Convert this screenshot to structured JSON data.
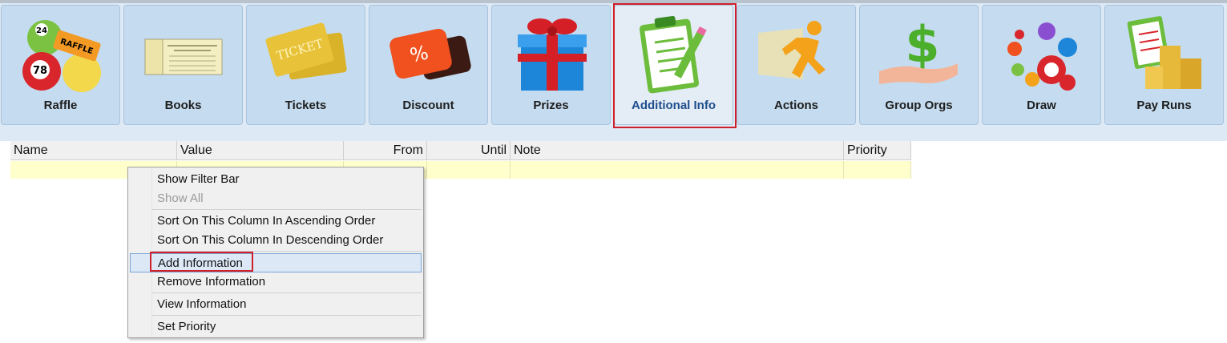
{
  "toolbar": {
    "buttons": [
      {
        "label": "Raffle",
        "icon": "raffle-balls-icon"
      },
      {
        "label": "Books",
        "icon": "books-icon"
      },
      {
        "label": "Tickets",
        "icon": "tickets-icon"
      },
      {
        "label": "Discount",
        "icon": "discount-icon"
      },
      {
        "label": "Prizes",
        "icon": "gift-icon"
      },
      {
        "label": "Additional Info",
        "icon": "clipboard-icon"
      },
      {
        "label": "Actions",
        "icon": "running-man-icon"
      },
      {
        "label": "Group Orgs",
        "icon": "hand-dollar-icon"
      },
      {
        "label": "Draw",
        "icon": "lottery-balls-icon"
      },
      {
        "label": "Pay Runs",
        "icon": "coins-clipboard-icon"
      }
    ],
    "active": "Additional Info",
    "colors": {
      "highlight_border": "#d0202a",
      "active_label": "#1f4e8c"
    }
  },
  "grid": {
    "columns": [
      "Name",
      "Value",
      "From",
      "Until",
      "Note",
      "Priority"
    ]
  },
  "context_menu": {
    "items": [
      {
        "label": "Show Filter Bar"
      },
      {
        "label": "Show All"
      },
      {
        "label": "Sort On This Column In Ascending Order"
      },
      {
        "label": "Sort On This Column In Descending Order"
      },
      {
        "label": "Add Information"
      },
      {
        "label": "Remove Information"
      },
      {
        "label": "View Information"
      },
      {
        "label": "Set Priority"
      }
    ]
  }
}
